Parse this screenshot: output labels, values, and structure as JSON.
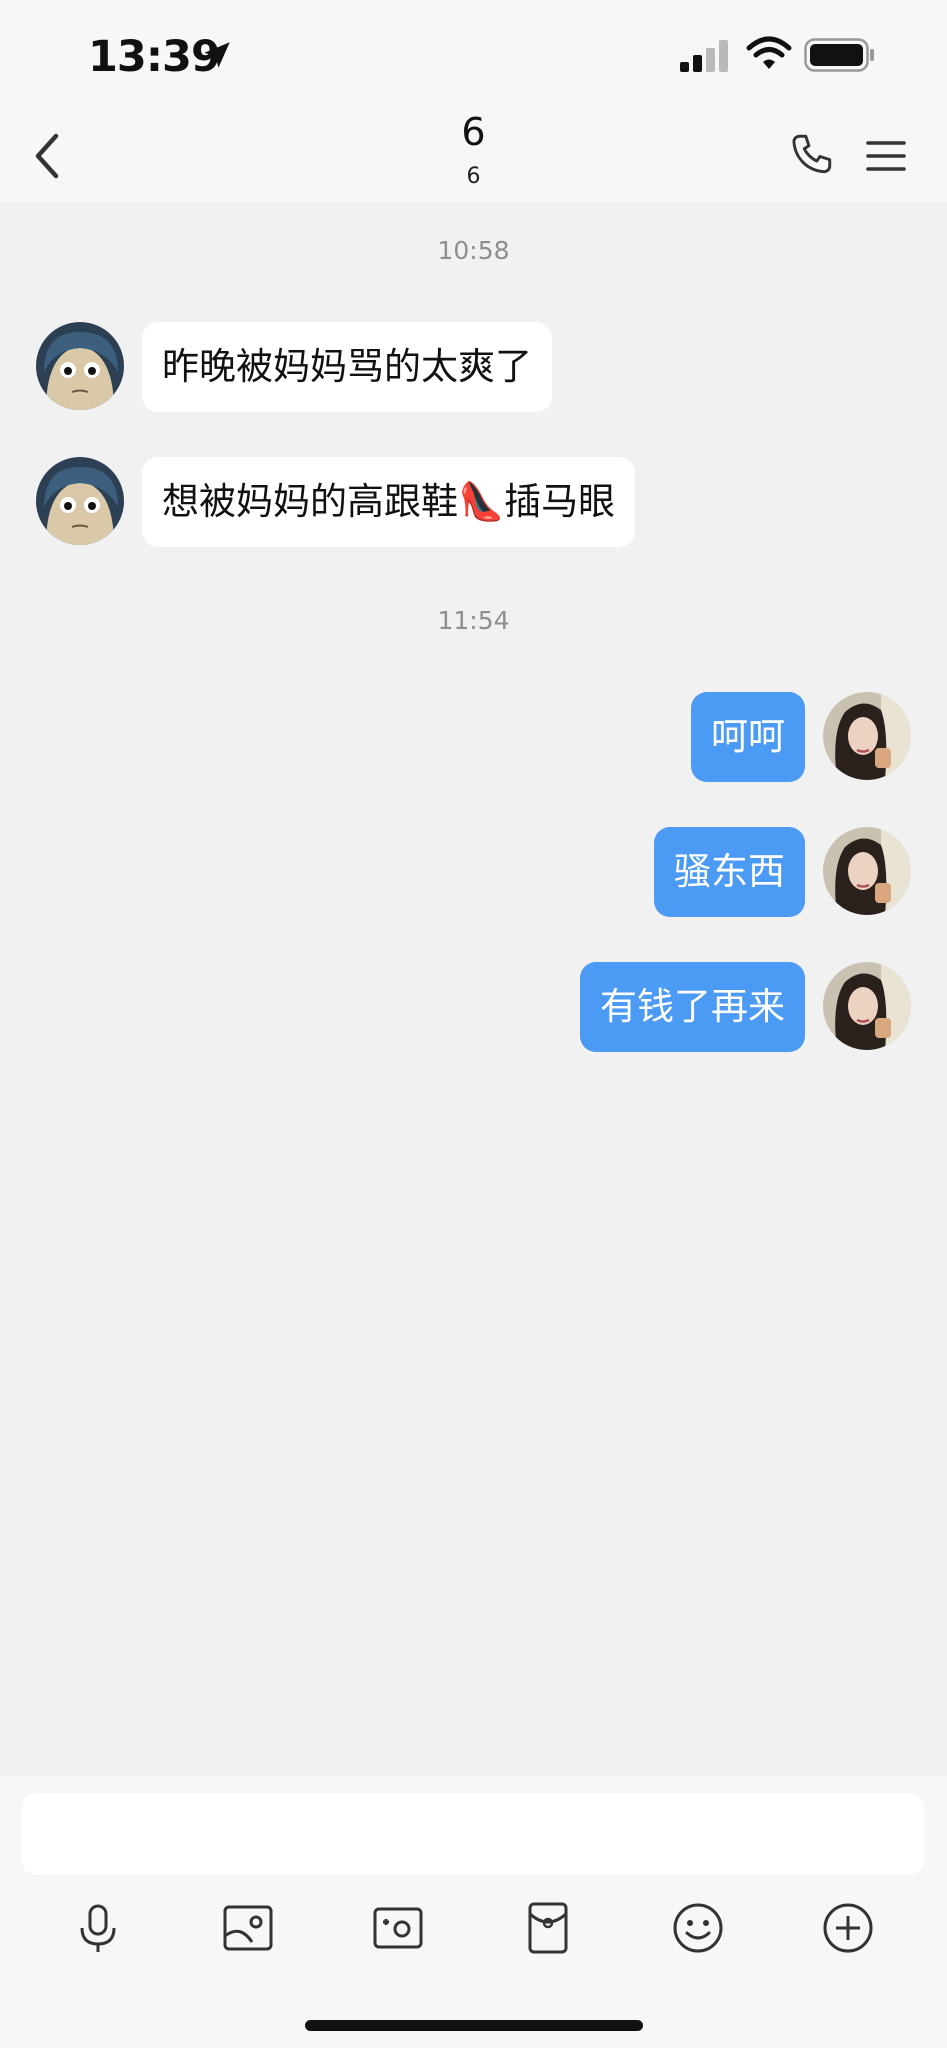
{
  "status_bar": {
    "time": "13:39",
    "icons": [
      "location-arrow-icon",
      "signal-icon",
      "wifi-icon",
      "battery-icon"
    ]
  },
  "nav": {
    "title": "6",
    "subtitle": "6",
    "icons": [
      "back-chevron-icon",
      "phone-icon",
      "menu-icon"
    ]
  },
  "chat": {
    "timestamps": [
      "10:58",
      "11:54"
    ],
    "incoming": [
      {
        "text": "昨晚被妈妈骂的太爽了"
      },
      {
        "text": "想被妈妈的高跟鞋👠插马眼"
      }
    ],
    "outgoing": [
      {
        "text": "呵呵"
      },
      {
        "text": "骚东西"
      },
      {
        "text": "有钱了再来"
      }
    ]
  },
  "input": {
    "placeholder": "",
    "tools": [
      "microphone-icon",
      "image-icon",
      "camera-icon",
      "red-packet-icon",
      "emoji-icon",
      "plus-circle-icon"
    ]
  },
  "colors": {
    "background": "#f1f1f2",
    "outgoing_bubble": "#4b9bf5",
    "incoming_bubble": "#ffffff",
    "timestamp": "#8e8e8e"
  }
}
